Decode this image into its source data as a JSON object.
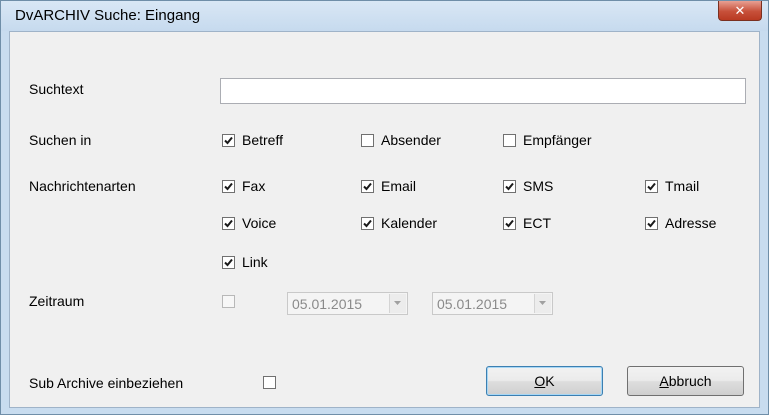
{
  "window": {
    "title": "DvARCHIV Suche: Eingang",
    "close_symbol": "✕"
  },
  "search": {
    "label": "Suchtext",
    "value": ""
  },
  "search_in": {
    "label": "Suchen in",
    "options": [
      {
        "label": "Betreff",
        "checked": true
      },
      {
        "label": "Absender",
        "checked": false
      },
      {
        "label": "Empfänger",
        "checked": false
      }
    ]
  },
  "message_types": {
    "label": "Nachrichtenarten",
    "options": [
      {
        "label": "Fax",
        "checked": true
      },
      {
        "label": "Email",
        "checked": true
      },
      {
        "label": "SMS",
        "checked": true
      },
      {
        "label": "Tmail",
        "checked": true
      },
      {
        "label": "Voice",
        "checked": true
      },
      {
        "label": "Kalender",
        "checked": true
      },
      {
        "label": "ECT",
        "checked": true
      },
      {
        "label": "Adresse",
        "checked": true
      },
      {
        "label": "Link",
        "checked": true
      }
    ]
  },
  "period": {
    "label": "Zeitraum",
    "enabled": false,
    "from": "05.01.2015",
    "to": "05.01.2015"
  },
  "sub_archive": {
    "label": "Sub Archive einbeziehen",
    "checked": false
  },
  "buttons": {
    "ok_accel": "O",
    "ok_rest": "K",
    "cancel_accel": "A",
    "cancel_rest": "bbruch"
  }
}
